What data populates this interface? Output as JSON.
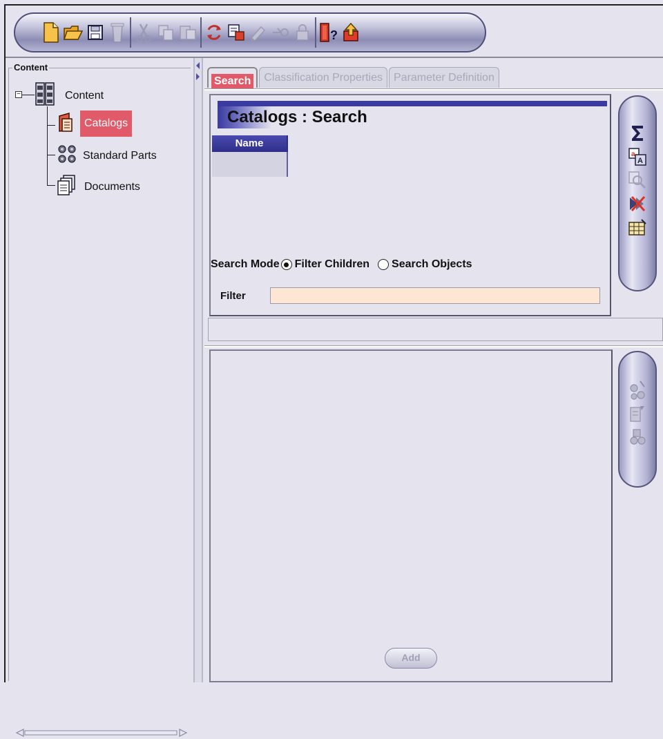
{
  "toolbar": {
    "buttons": [
      {
        "name": "new-document-icon",
        "enabled": true
      },
      {
        "name": "open-folder-icon",
        "enabled": true
      },
      {
        "name": "save-icon",
        "enabled": true
      },
      {
        "name": "delete-icon",
        "enabled": false
      },
      {
        "name": "cut-icon",
        "enabled": false
      },
      {
        "name": "copy-icon",
        "enabled": false
      },
      {
        "name": "paste-icon",
        "enabled": false
      },
      {
        "name": "refresh-icon",
        "enabled": true
      },
      {
        "name": "properties-icon",
        "enabled": true
      },
      {
        "name": "edit-icon",
        "enabled": false
      },
      {
        "name": "link-icon",
        "enabled": false
      },
      {
        "name": "lock-icon",
        "enabled": false
      },
      {
        "name": "help-icon",
        "enabled": true
      },
      {
        "name": "export-icon",
        "enabled": true
      }
    ]
  },
  "left_panel": {
    "title": "Content",
    "tree": {
      "root": {
        "label": "Content",
        "icon": "cabinet-icon",
        "expanded": true
      },
      "children": [
        {
          "label": "Catalogs",
          "icon": "catalog-icon",
          "selected": true
        },
        {
          "label": "Standard Parts",
          "icon": "standard-parts-icon",
          "selected": false
        },
        {
          "label": "Documents",
          "icon": "documents-icon",
          "selected": false
        }
      ]
    }
  },
  "tabs": [
    {
      "label": "Search",
      "active": true
    },
    {
      "label": "Classification Properties",
      "active": false
    },
    {
      "label": "Parameter Definition",
      "active": false
    }
  ],
  "search_panel": {
    "title": "Catalogs : Search",
    "table_header": "Name",
    "search_mode_label": "Search Mode",
    "options": [
      {
        "label": "Filter Children",
        "checked": true
      },
      {
        "label": "Search Objects",
        "checked": false
      }
    ],
    "filter_label": "Filter",
    "filter_value": ""
  },
  "search_side_tools": [
    "sum-icon",
    "find-replace-icon",
    "zoom-search-icon",
    "clear-filter-icon",
    "table-icon"
  ],
  "result_side_tools": [
    "parts-add-icon",
    "parts-edit-icon",
    "parts-remove-icon"
  ],
  "result_panel": {
    "add_label": "Add"
  }
}
